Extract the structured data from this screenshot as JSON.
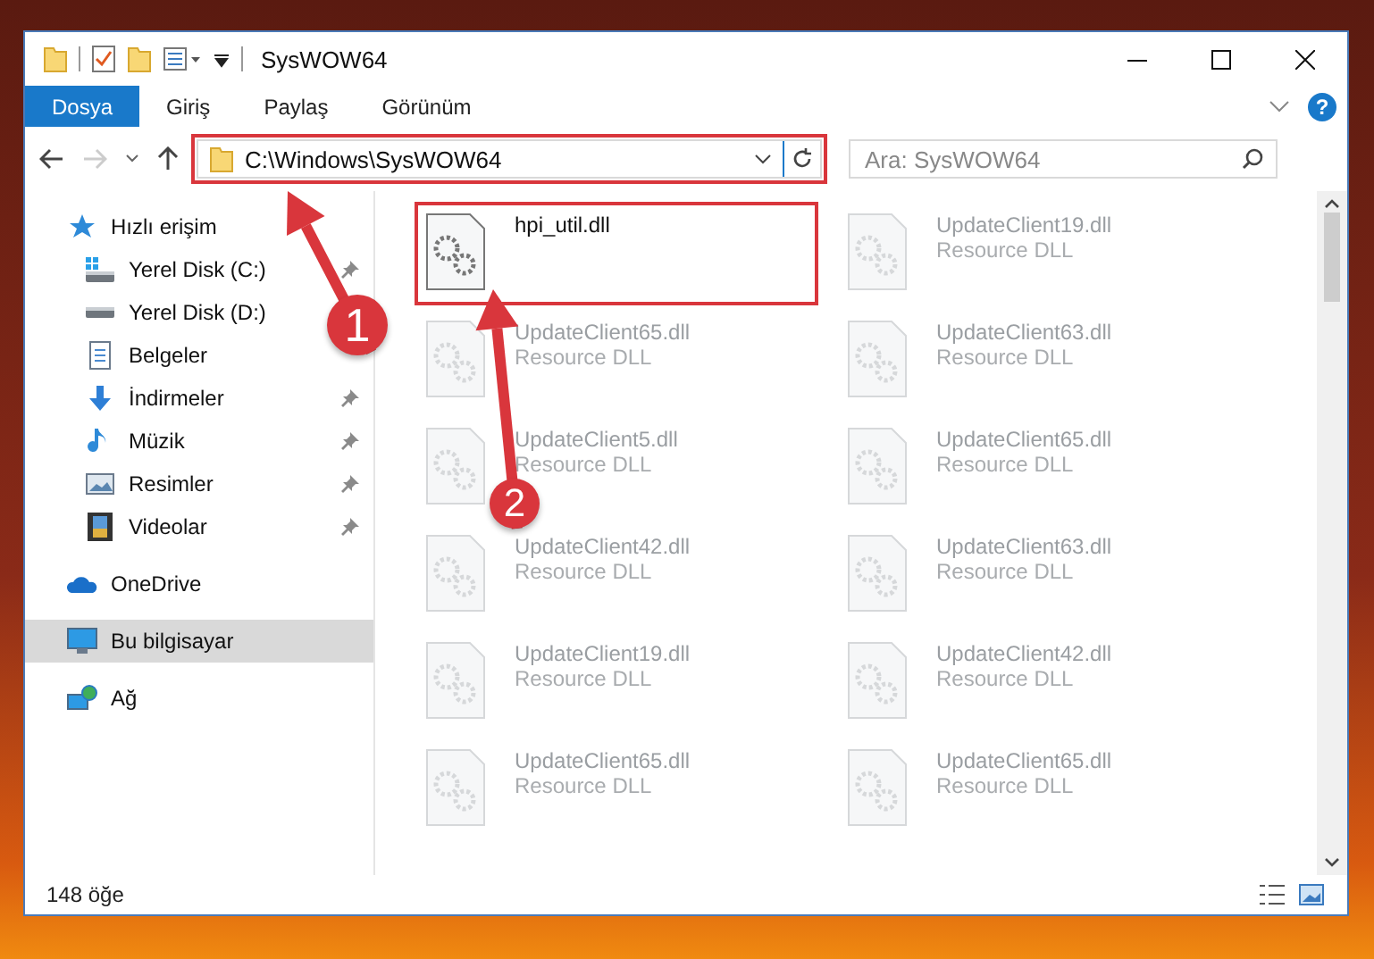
{
  "window": {
    "title": "SysWOW64"
  },
  "ribbon": {
    "tabs": [
      {
        "label": "Dosya",
        "kind": "file",
        "selected": false
      },
      {
        "label": "Giriş",
        "kind": "tab",
        "selected": false
      },
      {
        "label": "Paylaş",
        "kind": "tab",
        "selected": false
      },
      {
        "label": "Görünüm",
        "kind": "tab",
        "selected": false
      }
    ],
    "help": "?"
  },
  "address_bar": {
    "path": "C:\\Windows\\SysWOW64",
    "highlighted": true
  },
  "search": {
    "placeholder": "Ara: SysWOW64"
  },
  "sidebar": {
    "items": [
      {
        "label": "Hızlı erişim",
        "kind": "star",
        "pinned": false,
        "selected": false,
        "children": [
          {
            "label": "Yerel Disk (C:)",
            "kind": "drive-win",
            "pinned": true,
            "selected": false
          },
          {
            "label": "Yerel Disk (D:)",
            "kind": "drive",
            "pinned": false,
            "selected": false
          },
          {
            "label": "Belgeler",
            "kind": "docs",
            "pinned": false,
            "selected": false
          },
          {
            "label": "İndirmeler",
            "kind": "download",
            "pinned": true,
            "selected": false
          },
          {
            "label": "Müzik",
            "kind": "music",
            "pinned": true,
            "selected": false
          },
          {
            "label": "Resimler",
            "kind": "pictures",
            "pinned": true,
            "selected": false
          },
          {
            "label": "Videolar",
            "kind": "videos",
            "pinned": true,
            "selected": false
          }
        ]
      },
      {
        "label": "OneDrive",
        "kind": "cloud",
        "pinned": false,
        "selected": false
      },
      {
        "label": "Bu bilgisayar",
        "kind": "pc",
        "pinned": false,
        "selected": true
      },
      {
        "label": "Ağ",
        "kind": "network",
        "pinned": false,
        "selected": false
      }
    ]
  },
  "files": [
    {
      "name": "hpi_util.dll",
      "faded": false,
      "highlighted": true
    },
    {
      "name": "UpdateClient19.dll",
      "type": "Resource DLL",
      "faded": true,
      "highlighted": false
    },
    {
      "name": "UpdateClient65.dll",
      "type": "Resource DLL",
      "faded": true,
      "highlighted": false
    },
    {
      "name": "UpdateClient63.dll",
      "type": "Resource DLL",
      "faded": true,
      "highlighted": false
    },
    {
      "name": "UpdateClient5.dll",
      "type": "Resource DLL",
      "faded": true,
      "highlighted": false
    },
    {
      "name": "UpdateClient65.dll",
      "type": "Resource DLL",
      "faded": true,
      "highlighted": false
    },
    {
      "name": "UpdateClient42.dll",
      "type": "Resource DLL",
      "faded": true,
      "highlighted": false
    },
    {
      "name": "UpdateClient63.dll",
      "type": "Resource DLL",
      "faded": true,
      "highlighted": false
    },
    {
      "name": "UpdateClient19.dll",
      "type": "Resource DLL",
      "faded": true,
      "highlighted": false
    },
    {
      "name": "UpdateClient42.dll",
      "type": "Resource DLL",
      "faded": true,
      "highlighted": false
    },
    {
      "name": "UpdateClient65.dll",
      "type": "Resource DLL",
      "faded": true,
      "highlighted": false
    },
    {
      "name": "UpdateClient65.dll",
      "type": "Resource DLL",
      "faded": true,
      "highlighted": false
    }
  ],
  "status_bar": {
    "count": "148 öğe"
  },
  "annotations": [
    {
      "number": "1"
    },
    {
      "number": "2"
    }
  ]
}
